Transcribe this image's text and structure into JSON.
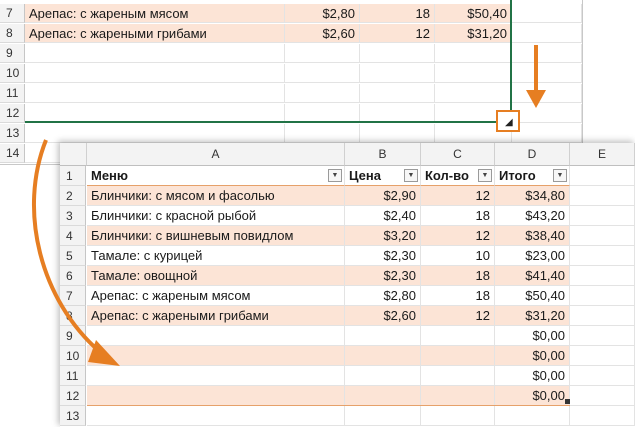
{
  "back_sheet": {
    "rows": [
      {
        "num": "7",
        "menu": "Арепас: с жареным мясом",
        "price": "$2,80",
        "qty": "18",
        "total": "$50,40",
        "band": true
      },
      {
        "num": "8",
        "menu": "Арепас: с жареными грибами",
        "price": "$2,60",
        "qty": "12",
        "total": "$31,20",
        "band": true
      },
      {
        "num": "9",
        "menu": "",
        "price": "",
        "qty": "",
        "total": "",
        "band": false
      },
      {
        "num": "10",
        "menu": "",
        "price": "",
        "qty": "",
        "total": "",
        "band": false
      },
      {
        "num": "11",
        "menu": "",
        "price": "",
        "qty": "",
        "total": "",
        "band": false
      },
      {
        "num": "12",
        "menu": "",
        "price": "",
        "qty": "",
        "total": "",
        "band": false
      },
      {
        "num": "13",
        "menu": "",
        "price": "",
        "qty": "",
        "total": "",
        "band": false
      },
      {
        "num": "14",
        "menu": "",
        "price": "",
        "qty": "",
        "total": "",
        "band": false
      }
    ]
  },
  "front_sheet": {
    "columns": [
      "A",
      "B",
      "C",
      "D",
      "E"
    ],
    "header_row": {
      "num": "1",
      "menu": "Меню",
      "price": "Цена",
      "qty": "Кол-во",
      "total": "Итого"
    },
    "filter_glyph": "▼",
    "rows": [
      {
        "num": "2",
        "menu": "Блинчики: с мясом и фасолью",
        "price": "$2,90",
        "qty": "12",
        "total": "$34,80",
        "band": true
      },
      {
        "num": "3",
        "menu": "Блинчики: с красной рыбой",
        "price": "$2,40",
        "qty": "18",
        "total": "$43,20",
        "band": false
      },
      {
        "num": "4",
        "menu": "Блинчики: с вишневым повидлом",
        "price": "$3,20",
        "qty": "12",
        "total": "$38,40",
        "band": true
      },
      {
        "num": "5",
        "menu": "Тамале: с курицей",
        "price": "$2,30",
        "qty": "10",
        "total": "$23,00",
        "band": false
      },
      {
        "num": "6",
        "menu": "Тамале: овощной",
        "price": "$2,30",
        "qty": "18",
        "total": "$41,40",
        "band": true
      },
      {
        "num": "7",
        "menu": "Арепас: с жареным мясом",
        "price": "$2,80",
        "qty": "18",
        "total": "$50,40",
        "band": false
      },
      {
        "num": "8",
        "menu": "Арепас: с жареными грибами",
        "price": "$2,60",
        "qty": "12",
        "total": "$31,20",
        "band": true
      },
      {
        "num": "9",
        "menu": "",
        "price": "",
        "qty": "",
        "total": "$0,00",
        "band": false
      },
      {
        "num": "10",
        "menu": "",
        "price": "",
        "qty": "",
        "total": "$0,00",
        "band": true
      },
      {
        "num": "11",
        "menu": "",
        "price": "",
        "qty": "",
        "total": "$0,00",
        "band": false
      },
      {
        "num": "12",
        "menu": "",
        "price": "",
        "qty": "",
        "total": "$0,00",
        "band": true
      },
      {
        "num": "13",
        "menu": "",
        "price": "",
        "qty": "",
        "total": "",
        "band": false
      }
    ]
  },
  "colors": {
    "band": "#fce4d6",
    "selection": "#217346",
    "arrow": "#e67e22",
    "header_bg": "#f3f3f3"
  }
}
